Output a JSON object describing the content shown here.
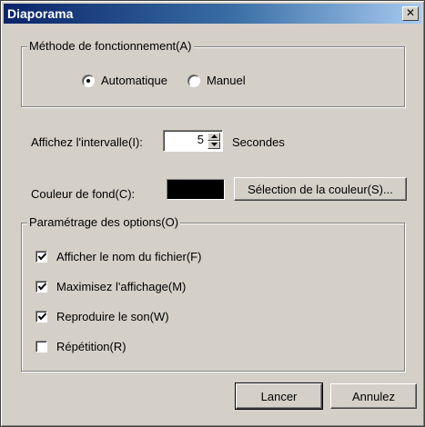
{
  "window": {
    "title": "Diaporama",
    "close_glyph": "✕"
  },
  "mode_group": {
    "legend": "Méthode de fonctionnement(A)",
    "options": [
      {
        "label": "Automatique",
        "selected": true
      },
      {
        "label": "Manuel",
        "selected": false
      }
    ]
  },
  "interval": {
    "label": "Affichez l'intervalle(I):",
    "value": "5",
    "unit": "Secondes"
  },
  "background_color": {
    "label": "Couleur de fond(C):",
    "swatch_color": "#000000",
    "select_button": "Sélection de la couleur(S)..."
  },
  "options_group": {
    "legend": "Paramétrage des options(O)",
    "items": [
      {
        "label": "Afficher le nom du fichier(F)",
        "checked": true
      },
      {
        "label": "Maximisez l'affichage(M)",
        "checked": true
      },
      {
        "label": "Reproduire le son(W)",
        "checked": true
      },
      {
        "label": "Répétition(R)",
        "checked": false
      }
    ]
  },
  "buttons": {
    "launch": "Lancer",
    "cancel": "Annulez"
  },
  "colors": {
    "title_bar_start": "#0a246a",
    "title_bar_end": "#a6caf0",
    "dialog_face": "#d4d0c8"
  },
  "icons": {
    "close": "close-icon",
    "spin_up": "arrow-up-icon",
    "spin_down": "arrow-down-icon",
    "check": "checkmark-icon"
  }
}
